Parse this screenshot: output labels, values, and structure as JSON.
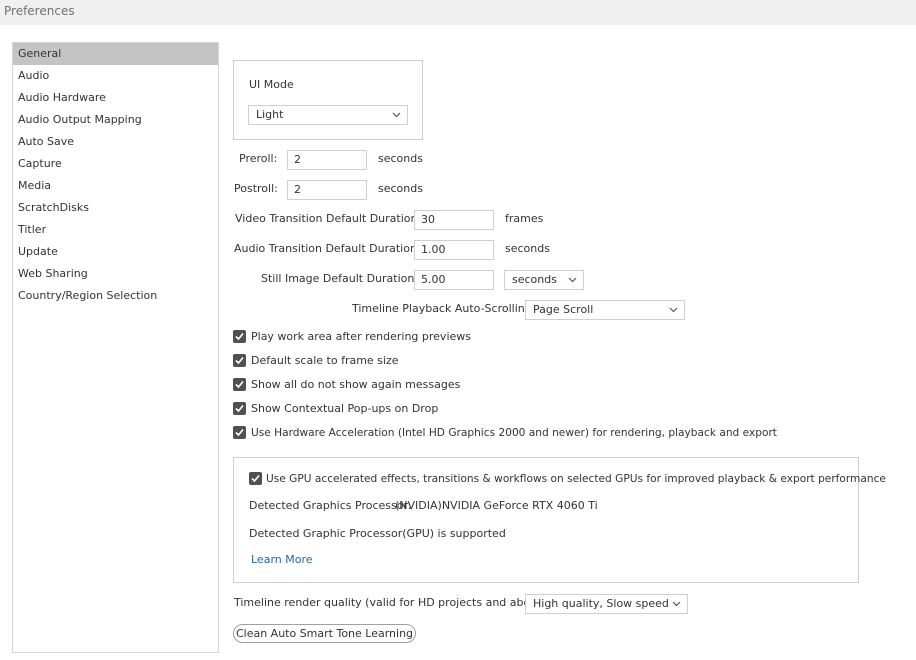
{
  "window": {
    "title": "Preferences"
  },
  "sidebar": {
    "items": [
      {
        "label": "General"
      },
      {
        "label": "Audio"
      },
      {
        "label": "Audio Hardware"
      },
      {
        "label": "Audio Output Mapping"
      },
      {
        "label": "Auto Save"
      },
      {
        "label": "Capture"
      },
      {
        "label": "Media"
      },
      {
        "label": "ScratchDisks"
      },
      {
        "label": "Titler"
      },
      {
        "label": "Update"
      },
      {
        "label": "Web Sharing"
      },
      {
        "label": "Country/Region Selection"
      }
    ],
    "selected": "General"
  },
  "general": {
    "ui_mode": {
      "label": "UI Mode",
      "value": "Light",
      "icon": "chevron-down-icon"
    },
    "preroll": {
      "label": "Preroll:",
      "value": "2",
      "unit": "seconds"
    },
    "postroll": {
      "label": "Postroll:",
      "value": "2",
      "unit": "seconds"
    },
    "video_transition": {
      "label": "Video Transition Default Duration:",
      "value": "30",
      "unit": "frames"
    },
    "audio_transition": {
      "label": "Audio Transition Default Duration:",
      "value": "1.00",
      "unit": "seconds"
    },
    "still_image": {
      "label": "Still Image Default Duration:",
      "value": "5.00",
      "unit": "seconds"
    },
    "timeline_scroll": {
      "label": "Timeline Playback Auto-Scrolling:",
      "value": "Page Scroll"
    },
    "checkboxes": [
      {
        "label": "Play work area after rendering previews",
        "checked": true
      },
      {
        "label": "Default scale to frame size",
        "checked": true
      },
      {
        "label": "Show all do not show again messages",
        "checked": true
      },
      {
        "label": "Show Contextual Pop-ups on Drop",
        "checked": true
      },
      {
        "label": "Use Hardware Acceleration (Intel HD Graphics 2000 and newer) for rendering, playback and export",
        "checked": true
      }
    ],
    "gpu": {
      "checkbox_label": "Use GPU accelerated effects, transitions & workflows on selected GPUs for improved playback & export performance",
      "checked": true,
      "detected_label": "Detected Graphics Processor:",
      "detected_value": "(NVIDIA)NVIDIA GeForce RTX 4060 Ti",
      "supported_text": "Detected Graphic Processor(GPU) is supported",
      "learn_more": "Learn More",
      "link_color": "#2266aa"
    },
    "render_quality": {
      "label": "Timeline render quality (valid for HD projects and above):",
      "value": "High quality, Slow speed"
    },
    "clean_button": "Clean Auto Smart Tone Learning"
  }
}
